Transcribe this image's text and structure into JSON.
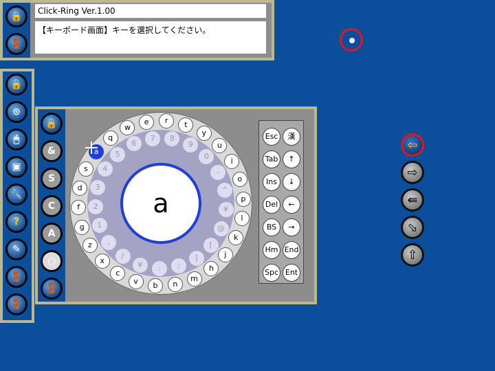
{
  "app": {
    "title": "Click-Ring Ver.1.00",
    "message": "【キーボード画面】キーを選択してください。"
  },
  "center_char": "a",
  "left_col_glyphs": [
    "🔒",
    "⊙",
    "🖱",
    "▣",
    "🔧",
    "?",
    "✎",
    "🚪",
    "🚪"
  ],
  "top_col_glyphs": [
    "🔒",
    "🚪"
  ],
  "mode_buttons": [
    "🔒",
    "&",
    "S",
    "C",
    "A",
    "○",
    "🚪"
  ],
  "outer_keys": [
    "e",
    "r",
    "t",
    "y",
    "u",
    "i",
    "o",
    "p",
    "l",
    "k",
    "j",
    "h",
    "m",
    "n",
    "b",
    "v",
    "c",
    "x",
    "z",
    "g",
    "f",
    "d",
    "s",
    "a",
    "q",
    "w"
  ],
  "inner_keys": [
    "8",
    "9",
    "0",
    "-",
    "^",
    "¥",
    "@",
    "[",
    "]",
    ";",
    ":",
    "¥",
    "/",
    ",",
    "1",
    "2",
    "3",
    "4",
    "5",
    "6",
    "7"
  ],
  "keypad": [
    [
      "Esc",
      "漢"
    ],
    [
      "Tab",
      "↑"
    ],
    [
      "Ins",
      "↓"
    ],
    [
      "Del",
      "←"
    ],
    [
      "BS",
      "→"
    ],
    [
      "Hm",
      "End"
    ],
    [
      "Spc",
      "Ent"
    ]
  ],
  "right_arrows": [
    "⇦",
    "⇨",
    "⇚",
    "⬂",
    "⇧"
  ]
}
